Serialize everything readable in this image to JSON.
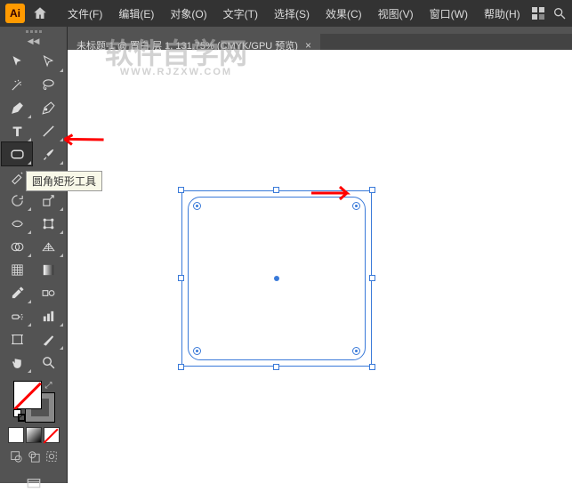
{
  "app": {
    "logo_text": "Ai"
  },
  "menu": {
    "file": "文件(F)",
    "edit": "编辑(E)",
    "object": "对象(O)",
    "type": "文字(T)",
    "select": "选择(S)",
    "effect": "效果(C)",
    "view": "视图(V)",
    "window": "窗口(W)",
    "help": "帮助(H)"
  },
  "tab": {
    "title": "未标题-1 @ 置白 层 1, 131.75% (CMYK/GPU 预览)",
    "close": "×"
  },
  "tooltip": {
    "rounded_rect": "圆角矩形工具"
  },
  "watermark": {
    "main": "软件自学网",
    "sub": "WWW.RJZXW.COM"
  },
  "icons": {
    "home": "home",
    "search": "search",
    "essentials": "essentials",
    "selection": "selection-tool",
    "direct": "direct-selection-tool",
    "wand": "magic-wand-tool",
    "lasso": "lasso-tool",
    "pen": "pen-tool",
    "curvature": "curvature-tool",
    "type": "type-tool",
    "line": "line-tool",
    "rect": "rounded-rectangle-tool",
    "brush": "paintbrush-tool",
    "shaper": "shaper-tool",
    "eraser": "eraser-tool",
    "rotate": "rotate-tool",
    "scale": "scale-tool",
    "width": "width-tool",
    "free": "free-transform-tool",
    "shape_builder": "shape-builder-tool",
    "perspective": "perspective-grid-tool",
    "mesh": "mesh-tool",
    "gradient": "gradient-tool",
    "eyedropper": "eyedropper-tool",
    "blend": "blend-tool",
    "symbol": "symbol-sprayer-tool",
    "graph": "column-graph-tool",
    "artboard": "artboard-tool",
    "slice": "slice-tool",
    "hand": "hand-tool",
    "zoom": "zoom-tool"
  }
}
